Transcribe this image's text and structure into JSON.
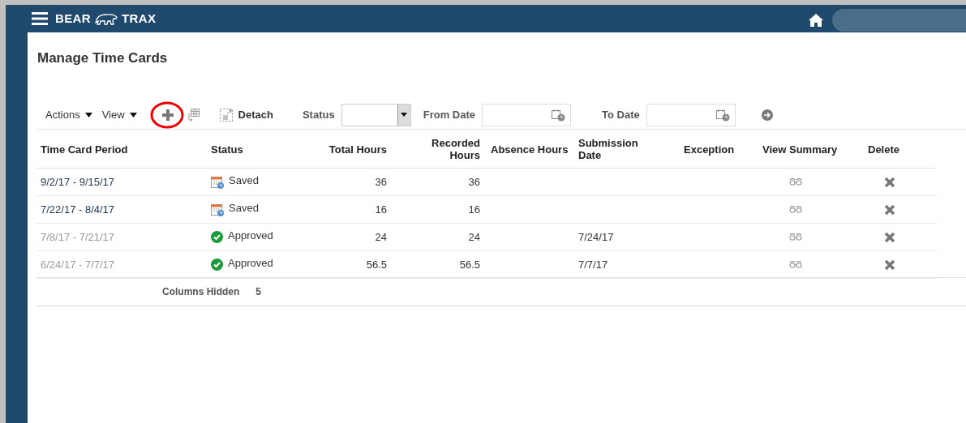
{
  "header": {
    "brand_left": "BEAR",
    "brand_right": "TRAX"
  },
  "page_title": "Manage Time Cards",
  "toolbar": {
    "menus": [
      "Actions",
      "View"
    ],
    "detach": "Detach",
    "filters": [
      {
        "kind": "select",
        "label": "Status"
      },
      {
        "kind": "date",
        "label": "From Date"
      },
      {
        "kind": "date",
        "label": "To Date"
      }
    ]
  },
  "table": {
    "columns": [
      "Time Card Period",
      "Status",
      "Total Hours",
      "Recorded Hours",
      "Absence Hours",
      "Submission Date",
      "Exception",
      "View Summary",
      "Delete"
    ],
    "rows": [
      {
        "period": "9/2/17 - 9/15/17",
        "disabled": false,
        "status": {
          "kind": "saved",
          "label": "Saved"
        },
        "total_hours": "36",
        "recorded_hours": "36"
      },
      {
        "period": "7/22/17 - 8/4/17",
        "disabled": false,
        "status": {
          "kind": "saved",
          "label": "Saved"
        },
        "total_hours": "16",
        "recorded_hours": "16"
      },
      {
        "period": "7/8/17 - 7/21/17",
        "disabled": true,
        "status": {
          "kind": "approved",
          "label": "Approved"
        },
        "total_hours": "24",
        "recorded_hours": "24",
        "submission_date": "7/24/17"
      },
      {
        "period": "6/24/17 - 7/7/17",
        "disabled": true,
        "status": {
          "kind": "approved",
          "label": "Approved"
        },
        "total_hours": "56.5",
        "recorded_hours": "56.5",
        "submission_date": "7/7/17"
      }
    ],
    "footer": {
      "label": "Columns Hidden",
      "value": "5"
    }
  }
}
